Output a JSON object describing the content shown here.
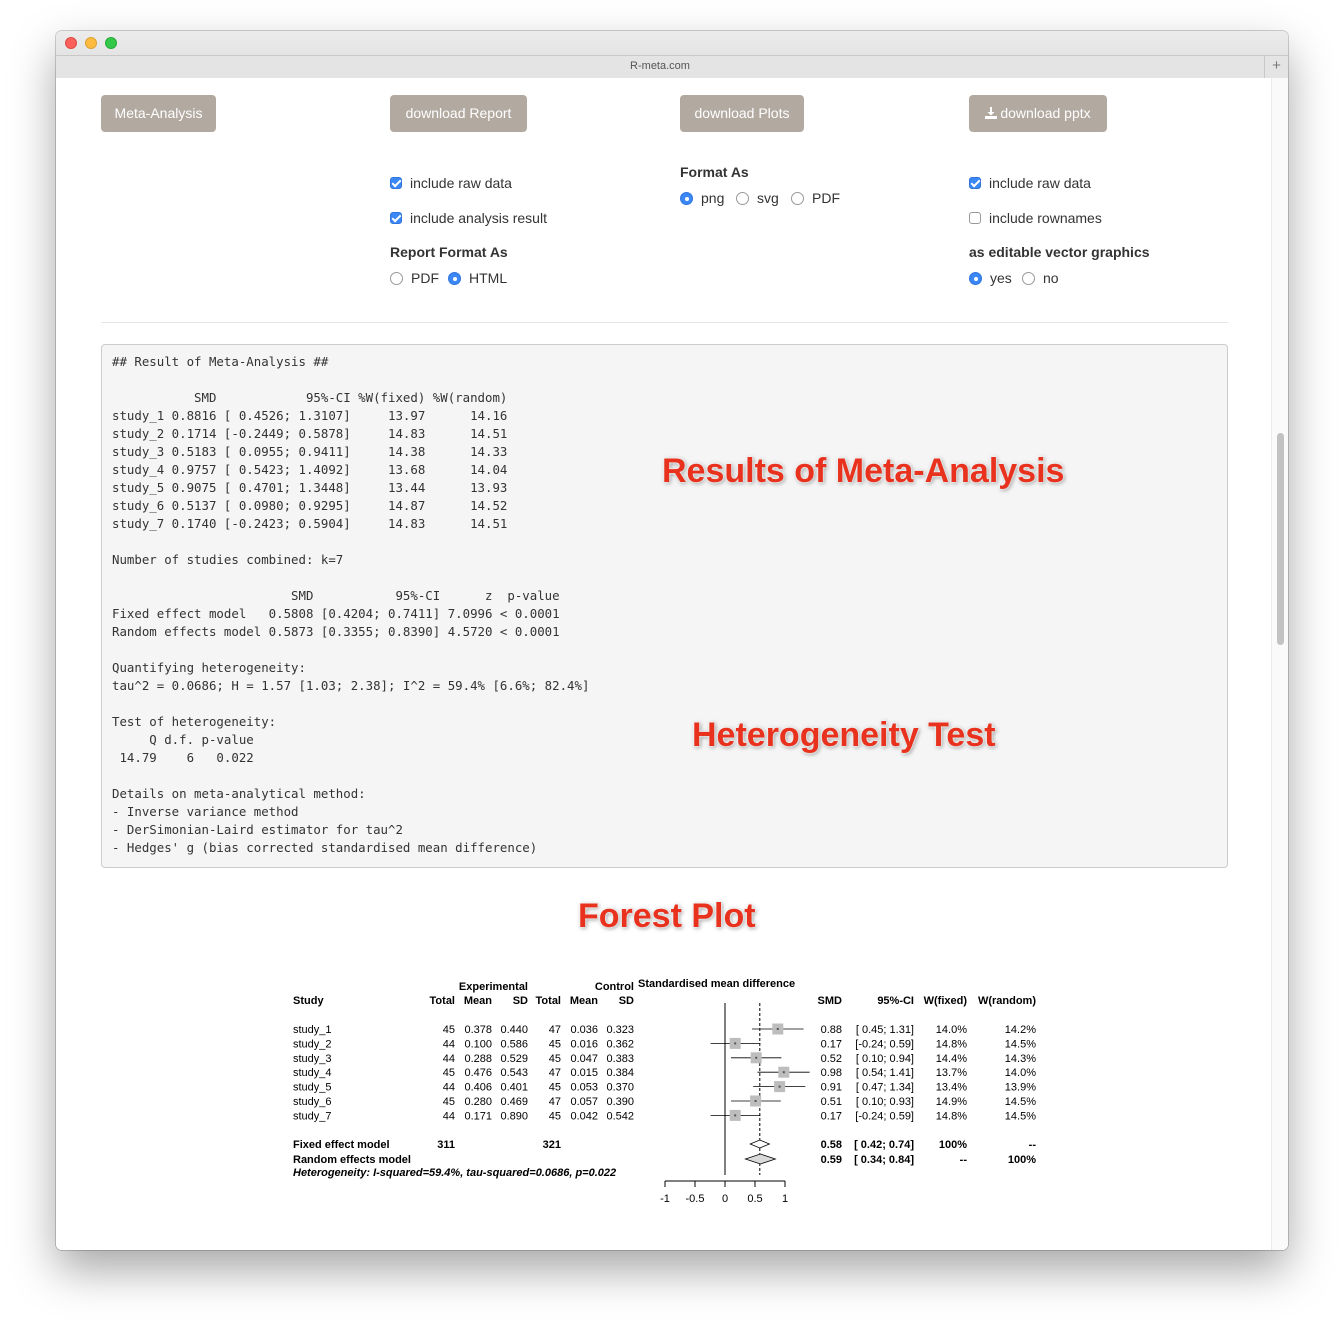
{
  "browser": {
    "title": "R-meta.com",
    "new_tab_symbol": "+"
  },
  "buttons": {
    "meta_analysis": "Meta-Analysis",
    "download_report": "download Report",
    "download_plots": "download Plots",
    "download_pptx": "download pptx",
    "download_icon": "download-icon"
  },
  "report": {
    "include_raw_data": "include raw data",
    "include_analysis_result": "include analysis result",
    "format_label": "Report Format As",
    "format_pdf": "PDF",
    "format_html": "HTML",
    "selected_format": "HTML"
  },
  "plots": {
    "format_label": "Format As",
    "png": "png",
    "svg": "svg",
    "pdf": "PDF",
    "selected_format": "png"
  },
  "pptx": {
    "include_raw_data": "include raw data",
    "include_rownames": "include rownames",
    "vector_label": "as editable vector graphics",
    "yes": "yes",
    "no": "no",
    "selected": "yes"
  },
  "result_text": "## Result of Meta-Analysis ##\n\n           SMD            95%-CI %W(fixed) %W(random)\nstudy_1 0.8816 [ 0.4526; 1.3107]     13.97      14.16\nstudy_2 0.1714 [-0.2449; 0.5878]     14.83      14.51\nstudy_3 0.5183 [ 0.0955; 0.9411]     14.38      14.33\nstudy_4 0.9757 [ 0.5423; 1.4092]     13.68      14.04\nstudy_5 0.9075 [ 0.4701; 1.3448]     13.44      13.93\nstudy_6 0.5137 [ 0.0980; 0.9295]     14.87      14.52\nstudy_7 0.1740 [-0.2423; 0.5904]     14.83      14.51\n\nNumber of studies combined: k=7\n\n                        SMD           95%-CI      z  p-value\nFixed effect model   0.5808 [0.4204; 0.7411] 7.0996 < 0.0001\nRandom effects model 0.5873 [0.3355; 0.8390] 4.5720 < 0.0001\n\nQuantifying heterogeneity:\ntau^2 = 0.0686; H = 1.57 [1.03; 2.38]; I^2 = 59.4% [6.6%; 82.4%]\n\nTest of heterogeneity:\n     Q d.f. p-value\n 14.79    6   0.022\n\nDetails on meta-analytical method:\n- Inverse variance method\n- DerSimonian-Laird estimator for tau^2\n- Hedges' g (bias corrected standardised mean difference)",
  "annotations": {
    "results": "Results of Meta-Analysis",
    "heterogeneity": "Heterogeneity Test",
    "forest": "Forest Plot"
  },
  "chart_data": {
    "type": "forest",
    "headers": {
      "experimental": "Experimental",
      "control": "Control",
      "smd_title": "Standardised mean difference",
      "study": "Study",
      "total": "Total",
      "mean": "Mean",
      "sd": "SD",
      "smd": "SMD",
      "ci": "95%-CI",
      "wfixed": "W(fixed)",
      "wrandom": "W(random)"
    },
    "studies": [
      {
        "name": "study_1",
        "e_total": "45",
        "e_mean": "0.378",
        "e_sd": "0.440",
        "c_total": "47",
        "c_mean": "0.036",
        "c_sd": "0.323",
        "smd": 0.88,
        "lower": 0.45,
        "upper": 1.31,
        "smd_text": "0.88",
        "ci_text": "[ 0.45; 1.31]",
        "wfixed": "14.0%",
        "wrandom": "14.2%"
      },
      {
        "name": "study_2",
        "e_total": "44",
        "e_mean": "0.100",
        "e_sd": "0.586",
        "c_total": "45",
        "c_mean": "0.016",
        "c_sd": "0.362",
        "smd": 0.17,
        "lower": -0.24,
        "upper": 0.59,
        "smd_text": "0.17",
        "ci_text": "[-0.24; 0.59]",
        "wfixed": "14.8%",
        "wrandom": "14.5%"
      },
      {
        "name": "study_3",
        "e_total": "44",
        "e_mean": "0.288",
        "e_sd": "0.529",
        "c_total": "45",
        "c_mean": "0.047",
        "c_sd": "0.383",
        "smd": 0.52,
        "lower": 0.1,
        "upper": 0.94,
        "smd_text": "0.52",
        "ci_text": "[ 0.10; 0.94]",
        "wfixed": "14.4%",
        "wrandom": "14.3%"
      },
      {
        "name": "study_4",
        "e_total": "45",
        "e_mean": "0.476",
        "e_sd": "0.543",
        "c_total": "47",
        "c_mean": "0.015",
        "c_sd": "0.384",
        "smd": 0.98,
        "lower": 0.54,
        "upper": 1.41,
        "smd_text": "0.98",
        "ci_text": "[ 0.54; 1.41]",
        "wfixed": "13.7%",
        "wrandom": "14.0%"
      },
      {
        "name": "study_5",
        "e_total": "44",
        "e_mean": "0.406",
        "e_sd": "0.401",
        "c_total": "45",
        "c_mean": "0.053",
        "c_sd": "0.370",
        "smd": 0.91,
        "lower": 0.47,
        "upper": 1.34,
        "smd_text": "0.91",
        "ci_text": "[ 0.47; 1.34]",
        "wfixed": "13.4%",
        "wrandom": "13.9%"
      },
      {
        "name": "study_6",
        "e_total": "45",
        "e_mean": "0.280",
        "e_sd": "0.469",
        "c_total": "47",
        "c_mean": "0.057",
        "c_sd": "0.390",
        "smd": 0.51,
        "lower": 0.1,
        "upper": 0.93,
        "smd_text": "0.51",
        "ci_text": "[ 0.10; 0.93]",
        "wfixed": "14.9%",
        "wrandom": "14.5%"
      },
      {
        "name": "study_7",
        "e_total": "44",
        "e_mean": "0.171",
        "e_sd": "0.890",
        "c_total": "45",
        "c_mean": "0.042",
        "c_sd": "0.542",
        "smd": 0.17,
        "lower": -0.24,
        "upper": 0.59,
        "smd_text": "0.17",
        "ci_text": "[-0.24; 0.59]",
        "wfixed": "14.8%",
        "wrandom": "14.5%"
      }
    ],
    "fixed": {
      "label": "Fixed effect model",
      "e_total": "311",
      "c_total": "321",
      "smd": 0.58,
      "lower": 0.42,
      "upper": 0.74,
      "smd_text": "0.58",
      "ci_text": "[ 0.42; 0.74]",
      "wfixed": "100%",
      "wrandom": "--"
    },
    "random": {
      "label": "Random effects model",
      "smd": 0.59,
      "lower": 0.34,
      "upper": 0.84,
      "smd_text": "0.59",
      "ci_text": "[ 0.34; 0.84]",
      "wfixed": "--",
      "wrandom": "100%"
    },
    "heterogeneity": "Heterogeneity: I-squared=59.4%, tau-squared=0.0686, p=0.022",
    "xticks": [
      -1,
      -0.5,
      0,
      0.5,
      1
    ],
    "xtick_labels": [
      "-1",
      "-0.5",
      "0",
      "0.5",
      "1"
    ],
    "xlim": [
      -1,
      1
    ]
  }
}
